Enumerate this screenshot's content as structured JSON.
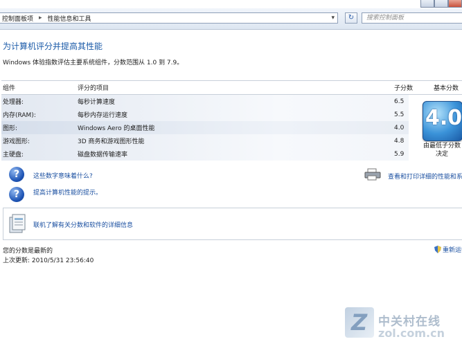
{
  "toolbar": {
    "breadcrumb": [
      "控制面板项",
      "性能信息和工具"
    ],
    "search_placeholder": "搜索控制面板"
  },
  "header": {
    "title": "为计算机评分并提高其性能",
    "subtitle": "Windows 体验指数评估主要系统组件，分数范围从 1.0 到 7.9。"
  },
  "table": {
    "headers": {
      "component": "组件",
      "rated": "评分的项目",
      "subscore": "子分数",
      "base": "基本分数"
    },
    "rows": [
      {
        "component": "处理器:",
        "item": "每秒计算速度",
        "subscore": "6.5"
      },
      {
        "component": "内存(RAM):",
        "item": "每秒内存运行速度",
        "subscore": "5.5"
      },
      {
        "component": "图形:",
        "item": "Windows Aero 的桌面性能",
        "subscore": "4.0"
      },
      {
        "component": "游戏图形:",
        "item": "3D 商务和游戏图形性能",
        "subscore": "4.8"
      },
      {
        "component": "主硬盘:",
        "item": "磁盘数据传输速率",
        "subscore": "5.9"
      }
    ],
    "base_score": "4.0",
    "base_caption": "由最低子分数决定"
  },
  "links": {
    "what_mean": "这些数字意味着什么?",
    "tips": "提高计算机性能的提示。",
    "print_details": "查看和打印详细的性能和系统",
    "learn_more": "联机了解有关分数和软件的详细信息"
  },
  "status": {
    "current": "您的分数是最新的",
    "last_update": "上次更新: 2010/5/31 23:56:40",
    "rerun": "重新运行"
  },
  "watermark": {
    "cn": "中关村在线",
    "en": "zol.com.cn"
  },
  "colors": {
    "title_blue": "#1a5aa8",
    "link_blue": "#1a4fa0"
  }
}
